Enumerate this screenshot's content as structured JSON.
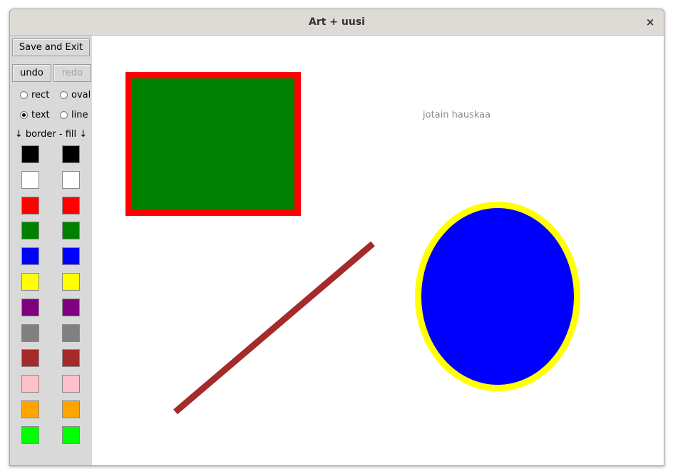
{
  "window": {
    "title": "Art + uusi",
    "close_glyph": "×"
  },
  "toolbar": {
    "save_exit_label": "Save and Exit",
    "undo_label": "undo",
    "redo_label": "redo"
  },
  "shape_modes": [
    {
      "key": "rect",
      "label": "rect",
      "checked": false
    },
    {
      "key": "oval",
      "label": "oval",
      "checked": false
    },
    {
      "key": "text",
      "label": "text",
      "checked": true
    },
    {
      "key": "line",
      "label": "line",
      "checked": false
    }
  ],
  "palette_header": "↓ border - fill ↓",
  "palette": [
    {
      "name": "black",
      "hex": "#000000"
    },
    {
      "name": "white",
      "hex": "#ffffff"
    },
    {
      "name": "red",
      "hex": "#ff0000"
    },
    {
      "name": "green",
      "hex": "#008000"
    },
    {
      "name": "blue",
      "hex": "#0000ff"
    },
    {
      "name": "yellow",
      "hex": "#ffff00"
    },
    {
      "name": "purple",
      "hex": "#800080"
    },
    {
      "name": "gray",
      "hex": "#808080"
    },
    {
      "name": "brown",
      "hex": "#a52a2a"
    },
    {
      "name": "pink",
      "hex": "#ffc0cb"
    },
    {
      "name": "orange",
      "hex": "#ffa500"
    },
    {
      "name": "lime",
      "hex": "#00ff00"
    }
  ],
  "canvas": {
    "text_item": "jotain hauskaa",
    "shapes": [
      {
        "type": "rect",
        "border": "#ff0000",
        "fill": "#008000"
      },
      {
        "type": "line",
        "color": "#a52a2a"
      },
      {
        "type": "oval",
        "border": "#ffff00",
        "fill": "#0000ff"
      }
    ]
  }
}
